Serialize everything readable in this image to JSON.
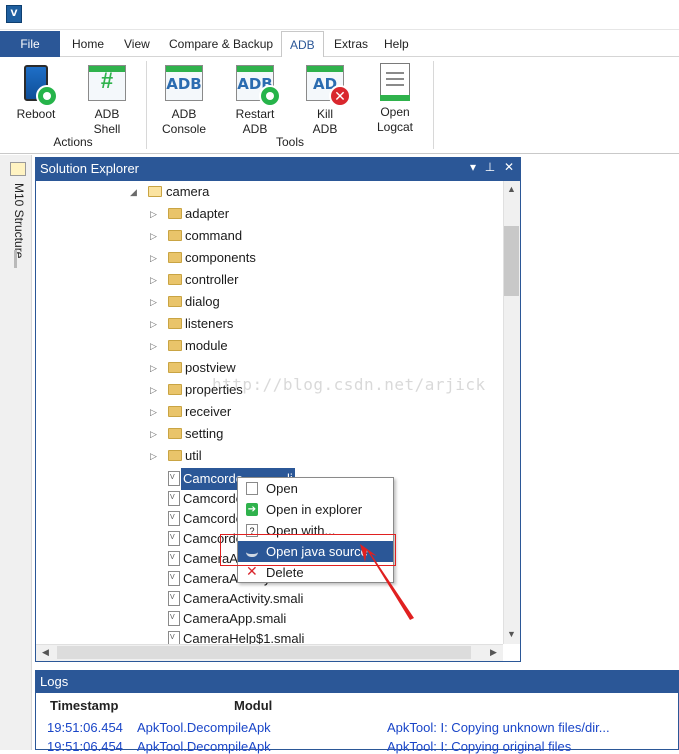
{
  "app": {
    "icon_text": "V"
  },
  "menu": {
    "file": "File",
    "tabs": [
      "Home",
      "View",
      "Compare & Backup",
      "ADB",
      "Extras",
      "Help"
    ],
    "active_tab": "ADB"
  },
  "ribbon": {
    "groups": [
      {
        "label": "Actions"
      },
      {
        "label": "Tools"
      }
    ],
    "buttons": [
      {
        "line1": "Reboot",
        "line2": ""
      },
      {
        "line1": "ADB",
        "line2": "Shell",
        "icon_text": "#"
      },
      {
        "line1": "ADB",
        "line2": "Console",
        "icon_text": "ADB"
      },
      {
        "line1": "Restart",
        "line2": "ADB",
        "icon_text": "ADB"
      },
      {
        "line1": "Kill",
        "line2": "ADB",
        "icon_text": "AD"
      },
      {
        "line1": "Open",
        "line2": "Logcat"
      }
    ]
  },
  "sidebar": {
    "label": "M10 Structure"
  },
  "explorer": {
    "title": "Solution Explorer",
    "root": "camera",
    "folders": [
      "adapter",
      "command",
      "components",
      "controller",
      "dialog",
      "listeners",
      "module",
      "postview",
      "properties",
      "receiver",
      "setting",
      "util"
    ],
    "files": [
      "Camcorde",
      "Camcorde",
      "Camcorde",
      "Camcorde",
      "CameraAc",
      "CameraActivity",
      "CameraActivity.smali",
      "CameraApp.smali",
      "CameraHelp$1.smali"
    ],
    "selected_file_suffix": "li"
  },
  "context_menu": {
    "items": [
      "Open",
      "Open in explorer",
      "Open with...",
      "Open java source",
      "Delete"
    ],
    "highlighted": "Open java source"
  },
  "logs": {
    "title": "Logs",
    "columns": [
      "Timestamp",
      "Modul"
    ],
    "rows": [
      {
        "time": "19:51:06.454",
        "module": "ApkTool.DecompileApk",
        "message": "ApkTool: I: Copying unknown files/dir..."
      },
      {
        "time": "19:51:06.454",
        "module": "ApkTool.DecompileApk",
        "message": "ApkTool: I: Copying original files"
      }
    ]
  },
  "watermark": "http://blog.csdn.net/arjick",
  "colors": {
    "accent": "#2b5797",
    "green": "#2fb24c",
    "red": "#d9272e",
    "log_text": "#1a46c8"
  }
}
